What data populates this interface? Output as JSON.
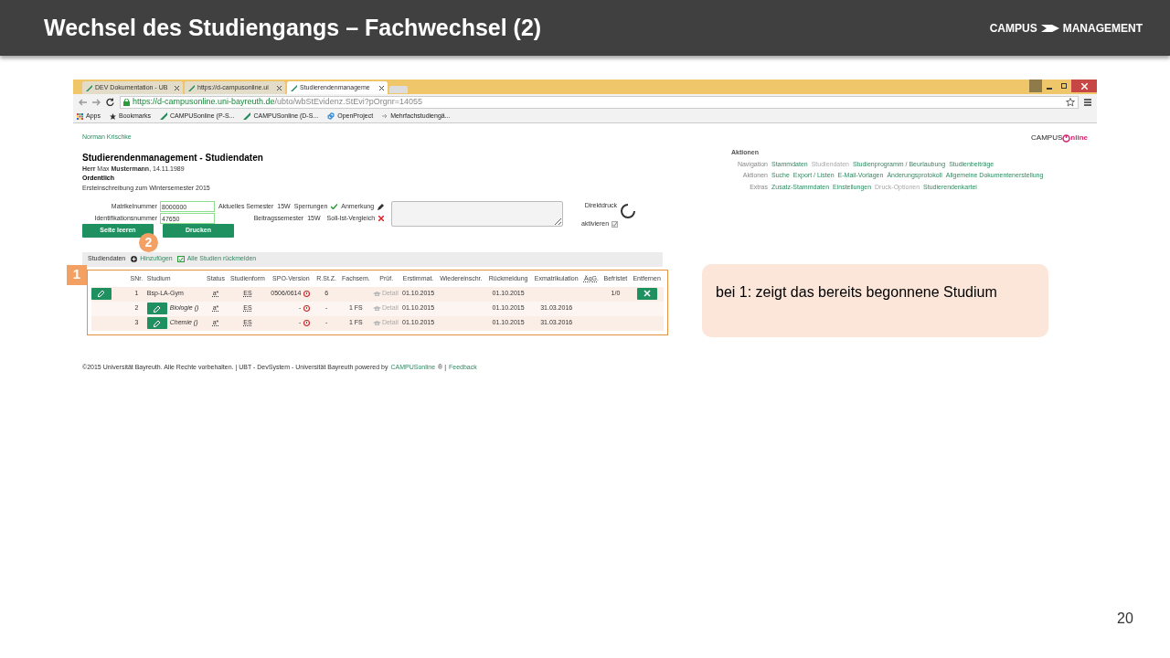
{
  "slide": {
    "title": "Wechsel des Studiengangs – Fachwechsel (2)",
    "logo": [
      "CAMPUS",
      "MANAGEMENT"
    ],
    "page_number": "20"
  },
  "browser": {
    "tabs": [
      {
        "label": "DEV Dokumentation - UB",
        "selected": false
      },
      {
        "label": "https://d-campusonline.ui",
        "selected": false
      },
      {
        "label": "Studierendenmanageme",
        "selected": true
      }
    ],
    "url": {
      "host": "https://d-campusonline.uni-bayreuth.de",
      "path": "/ubto/wbStEvidenz.StEvi?pOrgnr=14055"
    },
    "bookmarks": [
      {
        "kind": "apps",
        "label": "Apps"
      },
      {
        "kind": "star",
        "label": "Bookmarks"
      },
      {
        "kind": "leaf",
        "label": "CAMPUSonline (P-S..."
      },
      {
        "kind": "leaf",
        "label": "CAMPUSonline (D-S..."
      },
      {
        "kind": "link",
        "label": "OpenProject"
      },
      {
        "kind": "arrow",
        "label": "Mehrfachstudiengä..."
      }
    ]
  },
  "page": {
    "user": "Norman Krischke",
    "heading": "Studierendenmanagement - Studiendaten",
    "person": "**Herr** Max **Mustermann**, 14.11.1989",
    "status": "Ordentlich",
    "enrollment": "Ersteinschreibung zum Wintersemester 2015",
    "logo": [
      "CAMPUS",
      "nline"
    ],
    "actions": {
      "title": "Aktionen",
      "rows": [
        {
          "label": "Navigation",
          "links": [
            {
              "text": "Stammdaten",
              "disabled": false
            },
            {
              "text": "Studiendaten",
              "disabled": true
            },
            {
              "text": "Studienprogramm / Beurlaubung",
              "disabled": false
            },
            {
              "text": "Studienbeiträge",
              "disabled": false
            }
          ]
        },
        {
          "label": "Aktionen",
          "links": [
            {
              "text": "Suche",
              "disabled": false
            },
            {
              "text": "Export / Listen",
              "disabled": false
            },
            {
              "text": "E-Mail-Vorlagen",
              "disabled": false
            },
            {
              "text": "Änderungsprotokoll",
              "disabled": false
            },
            {
              "text": "Allgemeine Dokumentenerstellung",
              "disabled": false
            }
          ]
        },
        {
          "label": "Extras",
          "links": [
            {
              "text": "Zusatz-Stammdaten",
              "disabled": false
            },
            {
              "text": "Einstellungen",
              "disabled": false
            },
            {
              "text": "Druck-Optionen",
              "disabled": true
            },
            {
              "text": "Studierendenkartei",
              "disabled": false
            }
          ]
        }
      ]
    },
    "fields": [
      {
        "label": "Matrikelnummer",
        "value": "8000000"
      },
      {
        "label": "Identifikationsnummer",
        "value": "47650"
      }
    ],
    "infos": [
      {
        "label": "Aktuelles Semester",
        "value": "15W"
      },
      {
        "label": "Beitragssemester",
        "value": "15W"
      }
    ],
    "checks": [
      {
        "label": "Sperrungen",
        "ok": true
      },
      {
        "label": "Soll-Ist-Vergleich",
        "ok": false
      }
    ],
    "remark_label": "Anmerkung",
    "direct_print": {
      "label": "Direktdruck",
      "option": "aktivieren",
      "checked": true
    },
    "buttons": [
      "Seite leeren",
      "Drucken"
    ],
    "toolbar": {
      "title": "Studiendaten",
      "add": "Hinzufügen",
      "renew": "Alle Studien rückmelden"
    },
    "table": {
      "columns": [
        "SNr.",
        "Studium",
        "Status",
        "Studienform",
        "SPO-Version",
        "R.St.Z.",
        "Fachsem.",
        "Prüf.",
        "Erstimmat.",
        "Wiedereinschr.",
        "Rückmeldung",
        "Exmatrikulation",
        "ÄqG.",
        "Befristet",
        "Entfernen"
      ],
      "rows": [
        {
          "kind": "main",
          "nr": "1",
          "studium": "Bsp-LA-Gym",
          "status": "a*",
          "form": "ES",
          "spo": "0506/0614",
          "rstz": "6",
          "fachsem": "",
          "pruef": "Detail",
          "erst": "01.10.2015",
          "rueck": "01.10.2015",
          "exma": "",
          "befristet": "1/0"
        },
        {
          "kind": "sub",
          "nr": "2",
          "studium": "Biologie ()",
          "status": "a*",
          "form": "ES",
          "spo": "-",
          "rstz": "-",
          "fachsem": "1 FS",
          "pruef": "Detail",
          "erst": "01.10.2015",
          "rueck": "01.10.2015",
          "exma": "31.03.2016",
          "befristet": ""
        },
        {
          "kind": "sub",
          "nr": "3",
          "studium": "Chemie ()",
          "status": "a*",
          "form": "ES",
          "spo": "-",
          "rstz": "-",
          "fachsem": "1 FS",
          "pruef": "Detail",
          "erst": "01.10.2015",
          "rueck": "01.10.2015",
          "exma": "31.03.2016",
          "befristet": ""
        }
      ]
    },
    "footer": [
      {
        "kind": "text",
        "text": "©2015 Universität Bayreuth. Alle Rechte vorbehalten. | UBT - DevSystem - Universität Bayreuth powered by"
      },
      {
        "kind": "link",
        "text": "CAMPUSonline"
      },
      {
        "kind": "text",
        "text": "® |"
      },
      {
        "kind": "link",
        "text": "Feedback"
      }
    ]
  },
  "markers": [
    "1",
    "2"
  ],
  "callout": "bei 1: zeigt das bereits begonnene Studium"
}
